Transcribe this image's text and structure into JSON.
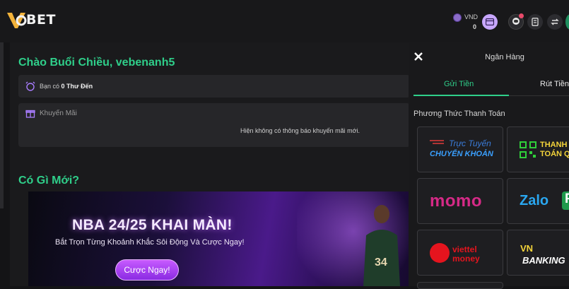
{
  "header": {
    "logo_text": "BET",
    "currency": "VND",
    "balance": "0"
  },
  "main": {
    "greeting": "Chào Buổi Chiều, vebenanh5",
    "visit_prefix": "Bạn có",
    "visit_value": "0 Thư Đến",
    "promo_heading": "Khuyến Mãi",
    "promo_empty": "Hiện không có thông báo khuyến mãi mới.",
    "news_heading": "Có Gì Mới?",
    "banner": {
      "title": "NBA 24/25 KHAI MÀN!",
      "subtitle": "Bắt Trọn Từng Khoảnh Khắc Sôi Động Và Cược Ngay!",
      "cta": "Cược Ngay!"
    }
  },
  "panel": {
    "title": "Ngân Hàng",
    "tabs": [
      {
        "label": "Gửi Tiền",
        "active": true
      },
      {
        "label": "Rút Tiền",
        "active": false
      }
    ],
    "section_title": "Phương Thức Thanh Toán",
    "methods": {
      "bank_transfer": {
        "line1": "Trực Tuyến",
        "line2": "CHUYỂN KHOẢN"
      },
      "qr_pay": {
        "line1": "THANH",
        "line2": "TOÁN Q"
      },
      "momo": "momo",
      "zalopay": {
        "zalo": "Zalo",
        "pay": "Pay"
      },
      "viettel_money": {
        "line1": "viettel",
        "line2": "money"
      },
      "vnbanking": {
        "line1": "VN",
        "line2": "BANKING"
      }
    }
  },
  "colors": {
    "accent_green": "#2fcf8a",
    "panel_bg": "#19191b",
    "cta_purple": "#a644f0"
  }
}
